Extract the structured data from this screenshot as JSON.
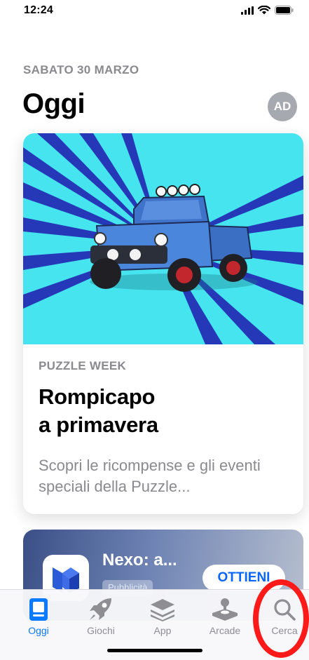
{
  "status_bar": {
    "time": "12:24"
  },
  "header": {
    "date": "SABATO 30 MARZO",
    "title": "Oggi",
    "avatar_initials": "AD"
  },
  "featured_card": {
    "eyebrow": "PUZZLE WEEK",
    "title_line1": "Rompicapo",
    "title_line2": "a primavera",
    "subtitle": "Scopri le ricompense e gli eventi speciali della Puzzle..."
  },
  "app_card": {
    "app_name": "Nexo: a...",
    "badge": "Pubblicità",
    "get_label": "OTTIENI"
  },
  "tab_bar": {
    "tabs": [
      {
        "label": "Oggi",
        "icon": "today-icon",
        "active": true
      },
      {
        "label": "Giochi",
        "icon": "rocket-icon",
        "active": false
      },
      {
        "label": "App",
        "icon": "stack-icon",
        "active": false
      },
      {
        "label": "Arcade",
        "icon": "joystick-icon",
        "active": false
      },
      {
        "label": "Cerca",
        "icon": "search-icon",
        "active": false
      }
    ]
  },
  "colors": {
    "accent": "#0a7aff",
    "hero_background": "#46e4ee",
    "annotation": "#ff1a1a"
  }
}
